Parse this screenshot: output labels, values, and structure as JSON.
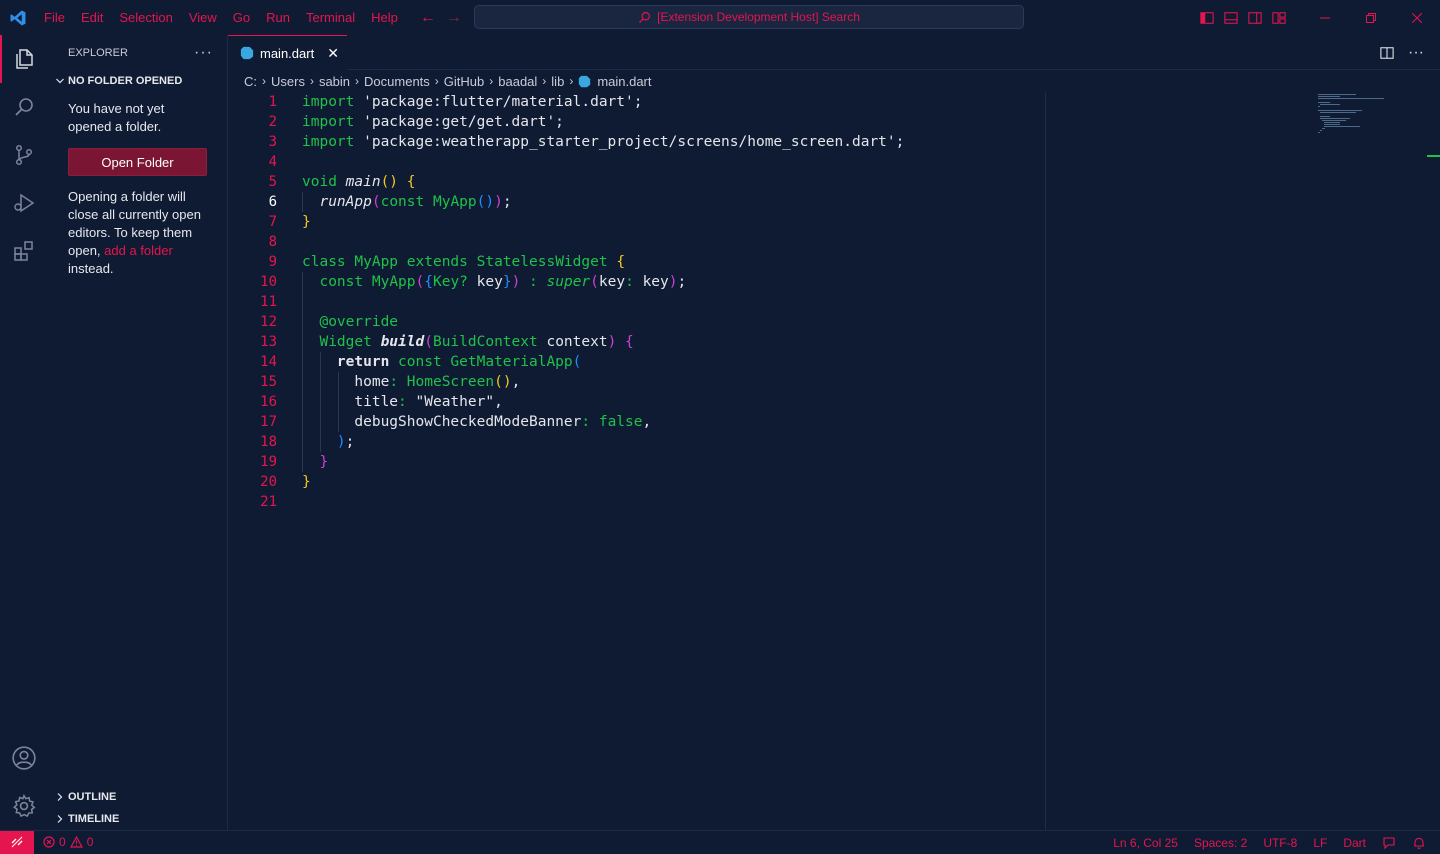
{
  "titlebar": {
    "menu": [
      "File",
      "Edit",
      "Selection",
      "View",
      "Go",
      "Run",
      "Terminal",
      "Help"
    ],
    "command_center": "[Extension Development Host] Search"
  },
  "sidebar": {
    "title": "EXPLORER",
    "more": "···",
    "section": "NO FOLDER OPENED",
    "message": "You have not yet opened a folder.",
    "open_folder_button": "Open Folder",
    "info_before": "Opening a folder will close all currently open editors. To keep them open, ",
    "info_link": "add a folder",
    "info_after": " instead.",
    "outline": "OUTLINE",
    "timeline": "TIMELINE"
  },
  "tab": {
    "label": "main.dart",
    "close": "✕"
  },
  "breadcrumb": [
    "C:",
    "Users",
    "sabin",
    "Documents",
    "GitHub",
    "baadal",
    "lib",
    "main.dart"
  ],
  "editor": {
    "line_numbers": [
      "1",
      "2",
      "3",
      "4",
      "5",
      "6",
      "7",
      "8",
      "9",
      "10",
      "11",
      "12",
      "13",
      "14",
      "15",
      "16",
      "17",
      "18",
      "19",
      "20",
      "21"
    ],
    "current_line": "6",
    "code": {
      "l1_kw": "import",
      "l1_str": " 'package:flutter/material.dart';",
      "l2_kw": "import",
      "l2_str": " 'package:get/get.dart';",
      "l3_kw": "import",
      "l3_str": " 'package:weatherapp_starter_project/screens/home_screen.dart';",
      "l5_kw": "void ",
      "l5_fn": "main",
      "l5_p": "()",
      "l5_b": " {",
      "l6_fn": "runApp",
      "l6_p1": "(",
      "l6_kw": "const ",
      "l6_cls": "MyApp",
      "l6_p2": "()",
      "l6_p3": ")",
      "l6_semi": ";",
      "l7_b": "}",
      "l9_kw": "class ",
      "l9_cls": "MyApp ",
      "l9_kw2": "extends ",
      "l9_cls2": "StatelessWidget ",
      "l9_b": "{",
      "l10_kw": "const ",
      "l10_cls": "MyApp",
      "l10_p1": "(",
      "l10_b1": "{",
      "l10_cls2": "Key? ",
      "l10_t": "key",
      "l10_b2": "}",
      "l10_p2": ")",
      "l10_colon": " : ",
      "l10_sup": "super",
      "l10_p3": "(",
      "l10_t2": "key",
      "l10_c2": ": ",
      "l10_t3": "key",
      "l10_p4": ")",
      "l10_semi": ";",
      "l12_ann": "@override",
      "l13_cls": "Widget ",
      "l13_fn": "build",
      "l13_p1": "(",
      "l13_cls2": "BuildContext ",
      "l13_t": "context",
      "l13_p2": ")",
      "l13_b": " {",
      "l14_kw2": "return ",
      "l14_kw": "const ",
      "l14_cls": "GetMaterialApp",
      "l14_p": "(",
      "l15_t": "home",
      "l15_c": ": ",
      "l15_cls": "HomeScreen",
      "l15_p": "()",
      "l15_comma": ",",
      "l16_t": "title",
      "l16_c": ": ",
      "l16_str": "\"Weather\"",
      "l16_comma": ",",
      "l17_t": "debugShowCheckedModeBanner",
      "l17_c": ": ",
      "l17_kw": "false",
      "l17_comma": ",",
      "l18_p": ")",
      "l18_semi": ";",
      "l19_b": "}",
      "l20_b": "}"
    }
  },
  "statusbar": {
    "errors": "0",
    "warnings": "0",
    "position": "Ln 6, Col 25",
    "spaces": "Spaces: 2",
    "encoding": "UTF-8",
    "eol": "LF",
    "language": "Dart"
  },
  "colors": {
    "accent": "#e5154f",
    "background": "#0f1b33",
    "keyword": "#20c14a"
  }
}
